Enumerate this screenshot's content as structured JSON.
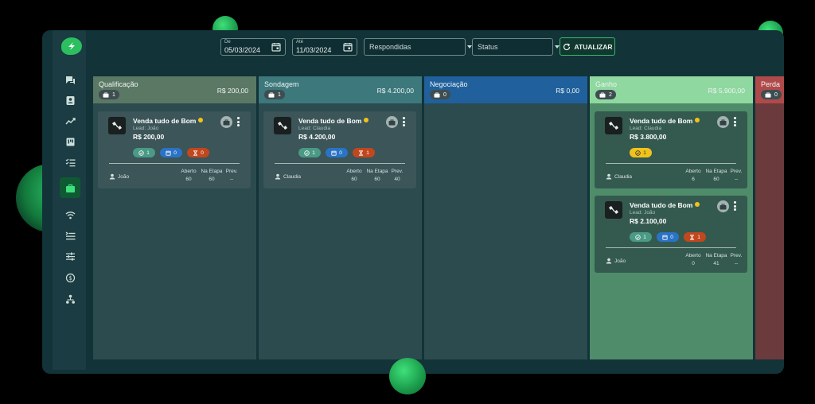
{
  "filters": {
    "start": {
      "label": "De",
      "value": "05/03/2024"
    },
    "end": {
      "label": "Até",
      "value": "11/03/2024"
    },
    "type": {
      "value": "Respondidas"
    },
    "status": {
      "value": "Status"
    },
    "refresh_label": "ATUALIZAR"
  },
  "sidebar": {
    "items": [
      {
        "name": "chat-icon"
      },
      {
        "name": "contact-card-icon"
      },
      {
        "name": "trend-chart-icon"
      },
      {
        "name": "kanban-icon"
      },
      {
        "name": "checklist-icon"
      },
      {
        "name": "briefcase-icon",
        "active": true
      },
      {
        "name": "wifi-icon"
      },
      {
        "name": "list-icon"
      },
      {
        "name": "sliders-icon"
      },
      {
        "name": "money-cycle-icon"
      },
      {
        "name": "org-chart-icon"
      }
    ]
  },
  "colors": {
    "qualificacao": "#5a7864",
    "sondagem": "#3c787c",
    "negociacao": "#20609c",
    "ganho": "#8fd8a0",
    "perda": "#b04a4a"
  },
  "columns": [
    {
      "title": "Qualificação",
      "total": "R$ 200,00",
      "count": "1",
      "cards": [
        {
          "title": "Venda tudo de Bom",
          "lead": "Lead: João",
          "value": "R$ 200,00",
          "pills": [
            {
              "type": "green",
              "value": "1"
            },
            {
              "type": "blue",
              "value": "0"
            },
            {
              "type": "red",
              "value": "0"
            }
          ],
          "owner": "João",
          "stats": {
            "aberto_label": "Aberto",
            "aberto": "60",
            "etapa_label": "Na Etapa",
            "etapa": "60",
            "prev_label": "Prev.",
            "prev": "--"
          }
        }
      ]
    },
    {
      "title": "Sondagem",
      "total": "R$ 4.200,00",
      "count": "1",
      "cards": [
        {
          "title": "Venda tudo de Bom",
          "lead": "Lead: Claudia",
          "value": "R$ 4.200,00",
          "pills": [
            {
              "type": "green",
              "value": "1"
            },
            {
              "type": "blue",
              "value": "0"
            },
            {
              "type": "red",
              "value": "1"
            }
          ],
          "owner": "Claudia",
          "stats": {
            "aberto_label": "Aberto",
            "aberto": "60",
            "etapa_label": "Na Etapa",
            "etapa": "60",
            "prev_label": "Prev.",
            "prev": "40"
          }
        }
      ]
    },
    {
      "title": "Negociação",
      "total": "R$ 0,00",
      "count": "0",
      "cards": []
    },
    {
      "title": "Ganho",
      "total": "R$ 5.900,00",
      "count": "2",
      "cards": [
        {
          "title": "Venda tudo de Bom",
          "lead": "Lead: Claudia",
          "value": "R$ 3.800,00",
          "pills": [
            {
              "type": "yellow",
              "value": "1"
            }
          ],
          "owner": "Claudia",
          "stats": {
            "aberto_label": "Aberto",
            "aberto": "6",
            "etapa_label": "Na Etapa",
            "etapa": "60",
            "prev_label": "Prev.",
            "prev": "--"
          }
        },
        {
          "title": "Venda tudo de Bom",
          "lead": "Lead: João",
          "value": "R$ 2.100,00",
          "pills": [
            {
              "type": "green",
              "value": "1"
            },
            {
              "type": "blue",
              "value": "0"
            },
            {
              "type": "red",
              "value": "1"
            }
          ],
          "owner": "João",
          "stats": {
            "aberto_label": "Aberto",
            "aberto": "0",
            "etapa_label": "Na Etapa",
            "etapa": "41",
            "prev_label": "Prev.",
            "prev": "--"
          }
        }
      ]
    },
    {
      "title": "Perda",
      "total": "",
      "count": "0",
      "cards": []
    }
  ]
}
